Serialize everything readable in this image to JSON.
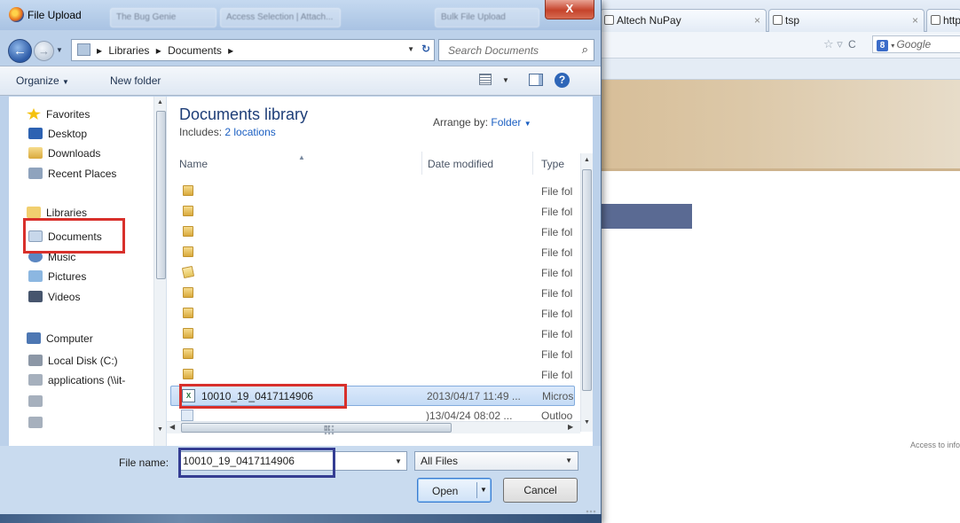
{
  "browser": {
    "tabs": [
      {
        "label": "Altech NuPay"
      },
      {
        "label": "tsp"
      },
      {
        "label": "http"
      }
    ],
    "search_engine_placeholder": "Google",
    "footer_text": "Access to info"
  },
  "dialog": {
    "title": "File Upload",
    "close_label": "X",
    "background_tabs": [
      "The Bug Genie",
      "Access Selection | Attach...",
      "Bulk File Upload"
    ],
    "breadcrumbs": [
      "Libraries",
      "Documents"
    ],
    "search_placeholder": "Search Documents",
    "toolbar": {
      "organize": "Organize",
      "new_folder": "New folder"
    },
    "nav": {
      "favorites": "Favorites",
      "favorites_items": [
        "Desktop",
        "Downloads",
        "Recent Places"
      ],
      "libraries": "Libraries",
      "libraries_items": [
        "Documents",
        "Music",
        "Pictures",
        "Videos"
      ],
      "computer": "Computer",
      "computer_items": [
        "Local Disk (C:)",
        "applications (\\\\it-"
      ]
    },
    "library": {
      "title": "Documents library",
      "includes_label": "Includes:",
      "includes_link": "2 locations",
      "arrange_label": "Arrange by:",
      "arrange_value": "Folder"
    },
    "columns": {
      "name": "Name",
      "date_modified": "Date modified",
      "type": "Type"
    },
    "rows": [
      {
        "name": "",
        "date": "",
        "type": "File fol",
        "icon": "folder"
      },
      {
        "name": "",
        "date": "",
        "type": "File fol",
        "icon": "folder"
      },
      {
        "name": "",
        "date": "",
        "type": "File fol",
        "icon": "folder"
      },
      {
        "name": "",
        "date": "",
        "type": "File fol",
        "icon": "folder"
      },
      {
        "name": "",
        "date": "",
        "type": "File fol",
        "icon": "folder-special"
      },
      {
        "name": "",
        "date": "",
        "type": "File fol",
        "icon": "folder"
      },
      {
        "name": "",
        "date": "",
        "type": "File fol",
        "icon": "folder"
      },
      {
        "name": "",
        "date": "",
        "type": "File fol",
        "icon": "folder"
      },
      {
        "name": "",
        "date": "",
        "type": "File fol",
        "icon": "folder"
      },
      {
        "name": "",
        "date": "",
        "type": "File fol",
        "icon": "folder"
      },
      {
        "name": "10010_19_0417114906",
        "date": "2013/04/17 11:49 ...",
        "type": "Micros",
        "icon": "excel-file",
        "selected": true
      },
      {
        "name": "",
        "date": ")13/04/24 08:02 ...",
        "type": "Outloo",
        "icon": "outlook-file"
      }
    ],
    "file_name_label": "File name:",
    "file_name_value": "10010_19_0417114906",
    "filter_value": "All Files",
    "open_label": "Open",
    "cancel_label": "Cancel",
    "scroll_grip": "III"
  },
  "colors": {
    "annotation_red": "#d8302b",
    "annotation_blue": "#343d93",
    "link_blue": "#1b5fc2",
    "library_title": "#1e3e78"
  }
}
